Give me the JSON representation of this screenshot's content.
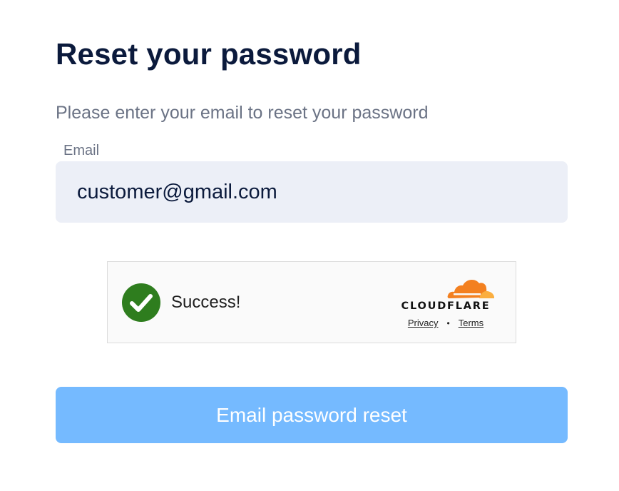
{
  "page": {
    "title": "Reset your password",
    "subtitle": "Please enter your email to reset your password"
  },
  "form": {
    "email_label": "Email",
    "email_value": "customer@gmail.com",
    "submit_label": "Email password reset"
  },
  "captcha": {
    "status": "Success!",
    "provider": "CLOUDFLARE",
    "privacy_label": "Privacy",
    "separator": "•",
    "terms_label": "Terms",
    "check_icon": "check-circle-icon",
    "logo_icon": "cloudflare-cloud-icon"
  },
  "colors": {
    "title": "#0b1a3c",
    "muted_text": "#6b7385",
    "input_bg": "#eceff7",
    "success_green": "#2e7d1e",
    "cloudflare_orange": "#f38020",
    "cloudflare_light_orange": "#faae40",
    "button_bg": "#75baff"
  }
}
